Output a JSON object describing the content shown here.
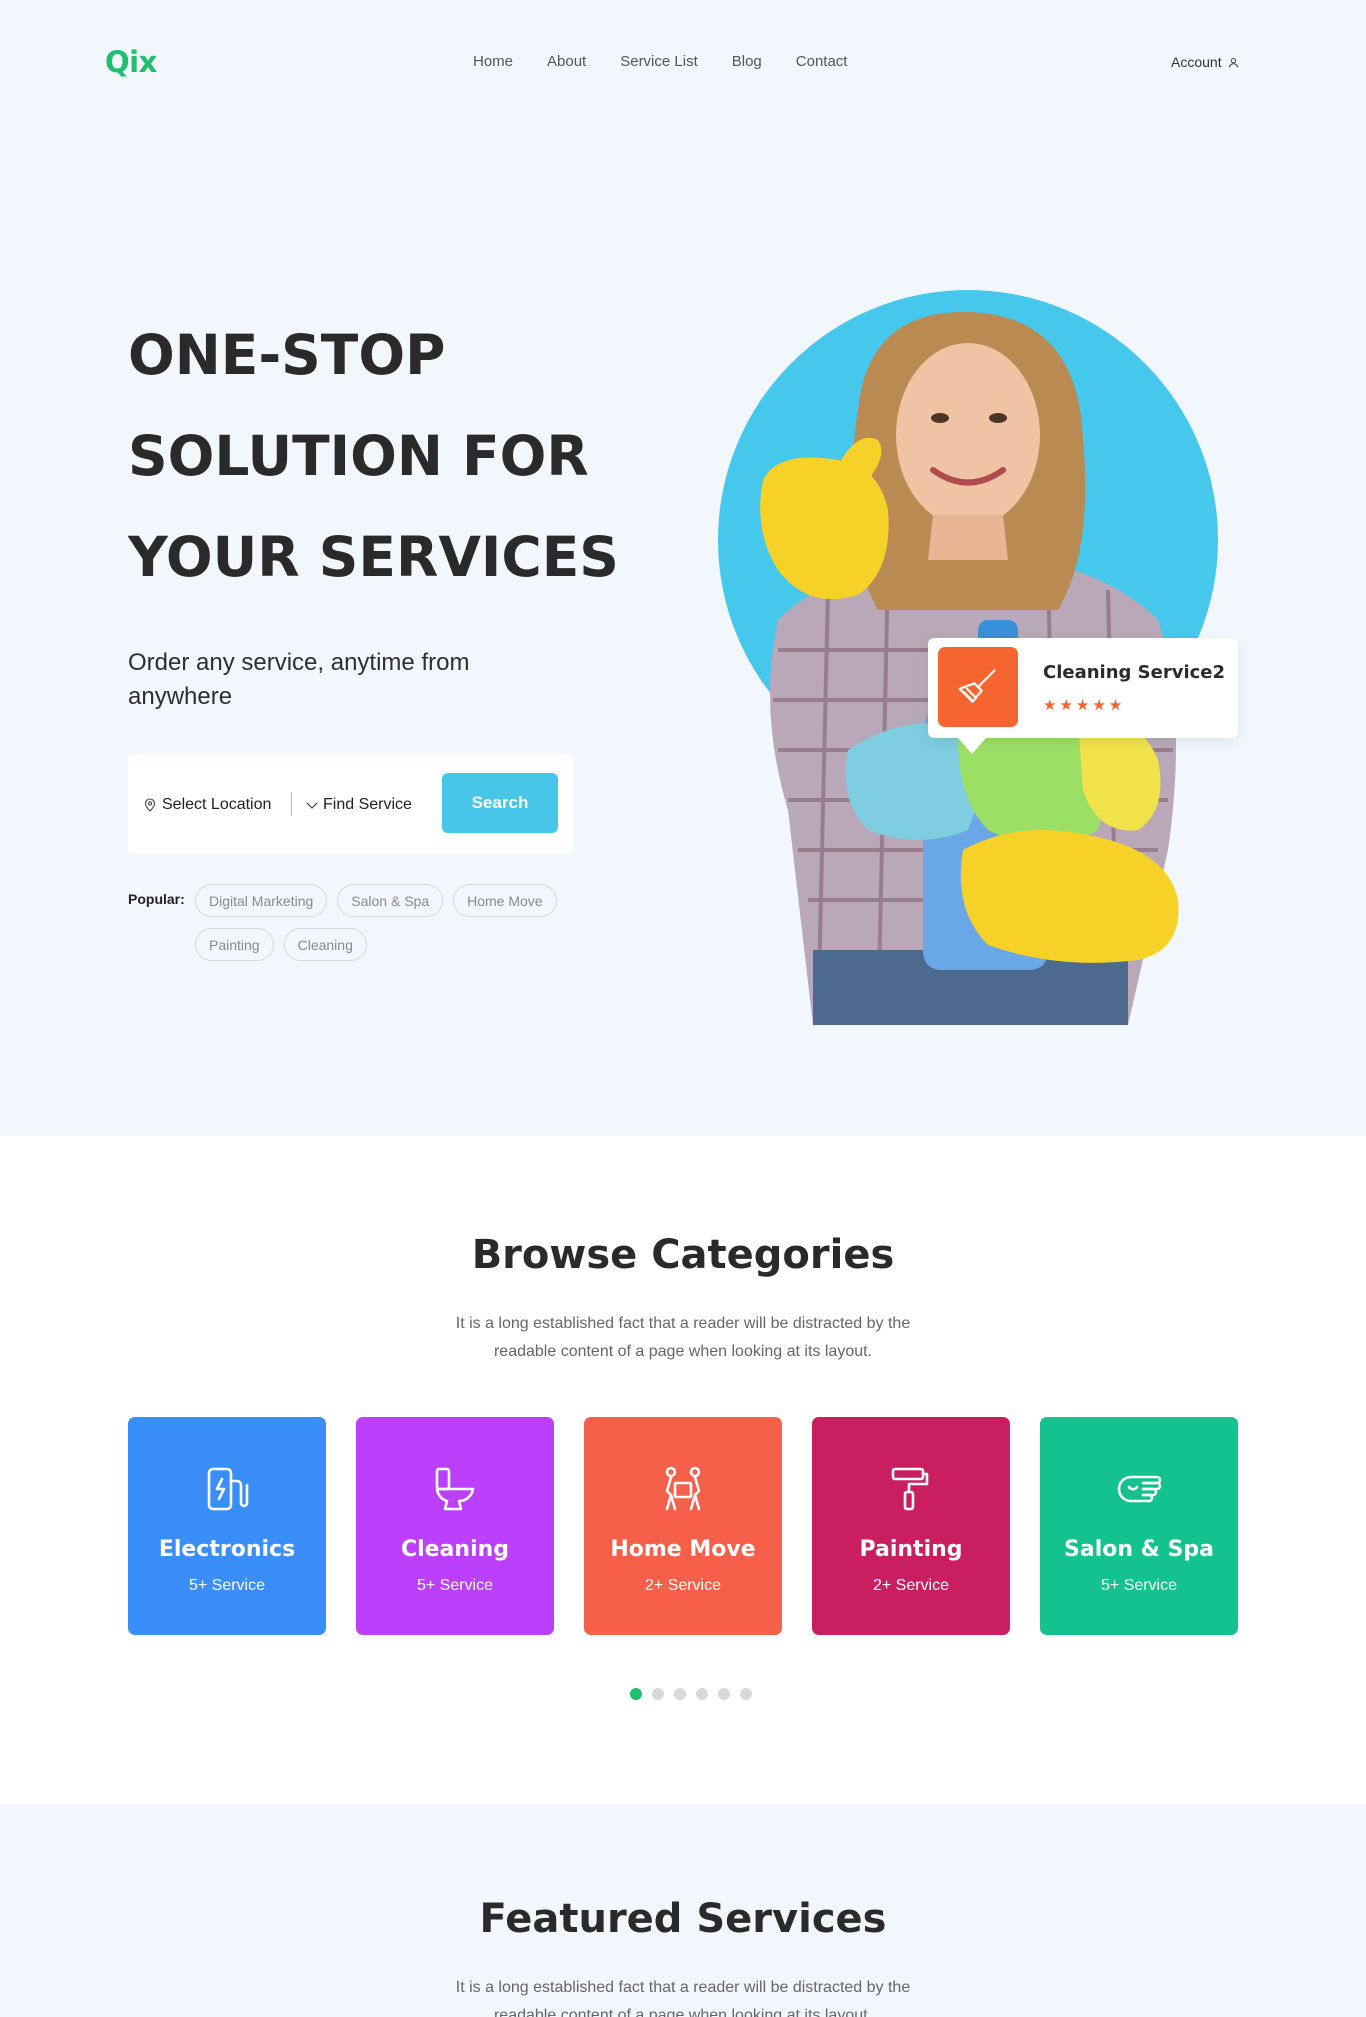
{
  "header": {
    "logo": "Qix",
    "nav": [
      "Home",
      "About",
      "Service List",
      "Blog",
      "Contact"
    ],
    "account": "Account"
  },
  "hero": {
    "title_lines": [
      "ONE-STOP",
      "SOLUTION FOR",
      "YOUR SERVICES"
    ],
    "subtitle": "Order any service, anytime from anywhere",
    "search": {
      "location": "Select Location",
      "service": "Find Service",
      "button": "Search"
    },
    "popular_label": "Popular:",
    "popular_tags": [
      "Digital Marketing",
      "Salon & Spa",
      "Home Move",
      "Painting",
      "Cleaning"
    ],
    "card": {
      "title": "Cleaning Service2",
      "stars": "★★★★★",
      "rating": 5
    }
  },
  "browse": {
    "title": "Browse Categories",
    "description": "It is a long established fact that a reader will be distracted by the readable content of a page when looking at its layout.",
    "categories": [
      {
        "name": "Electronics",
        "count": "5+ Service",
        "color": "#3a8ef9",
        "icon": "electronics-icon"
      },
      {
        "name": "Cleaning",
        "count": "5+ Service",
        "color": "#bc40fb",
        "icon": "toilet-icon"
      },
      {
        "name": "Home Move",
        "count": "2+ Service",
        "color": "#f65f49",
        "icon": "movers-icon"
      },
      {
        "name": "Painting",
        "count": "2+ Service",
        "color": "#c91f60",
        "icon": "paint-roller-icon"
      },
      {
        "name": "Salon & Spa",
        "count": "5+ Service",
        "color": "#13c28f",
        "icon": "massage-hand-icon"
      }
    ],
    "dots": 6,
    "active_dot": 0
  },
  "featured": {
    "title": "Featured Services",
    "description": "It is a long established fact that a reader will be distracted by the readable content of a page when looking at its layout."
  },
  "colors": {
    "brand": "#1fbf6e",
    "accent": "#47c6ea",
    "star": "#f4622d"
  }
}
